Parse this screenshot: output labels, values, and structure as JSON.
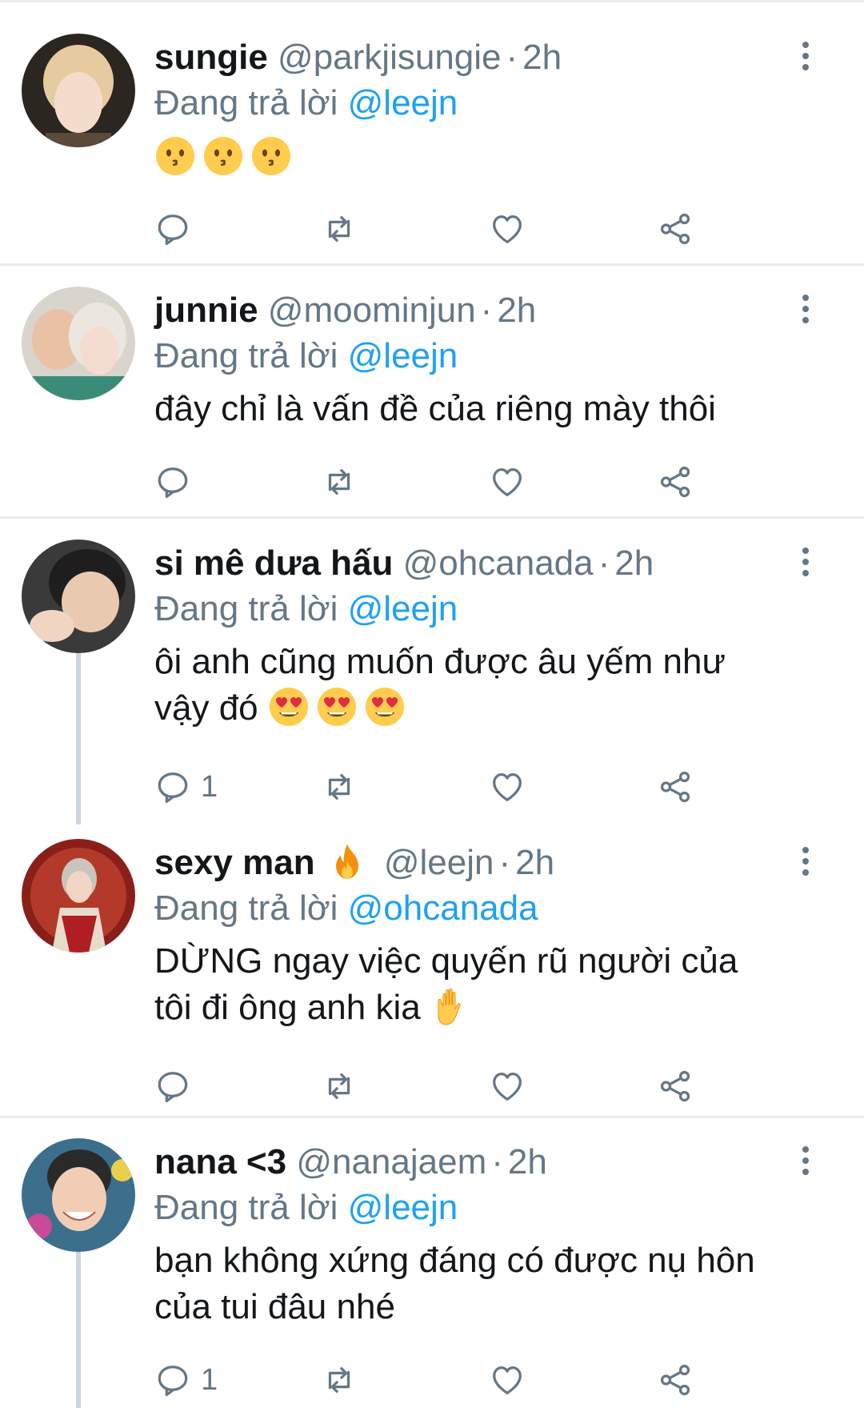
{
  "tweets": [
    {
      "name": "sungie",
      "handle": "@parkjisungie",
      "time": "2h",
      "reply_prefix": "Đang trả lời",
      "reply_to": "@leejn",
      "body_lines": [
        ""
      ],
      "emojis": [
        "kissing-face",
        "kissing-face",
        "kissing-face"
      ],
      "reply_count": ""
    },
    {
      "name": "junnie",
      "handle": "@moominjun",
      "time": "2h",
      "reply_prefix": "Đang trả lời",
      "reply_to": "@leejn",
      "body_lines": [
        "đây chỉ là vấn đề của riêng mày thôi"
      ],
      "reply_count": ""
    },
    {
      "name": "si mê dưa hấu",
      "handle": "@ohcanada",
      "time": "2h",
      "reply_prefix": "Đang trả lời",
      "reply_to": "@leejn",
      "body_lines": [
        "ôi anh cũng muốn được âu yếm như",
        "vậy đó"
      ],
      "emojis": [
        "heart-eyes-face",
        "heart-eyes-face",
        "heart-eyes-face"
      ],
      "reply_count": "1"
    },
    {
      "name": "sexy man",
      "name_emoji": "fire",
      "handle": "@leejn",
      "time": "2h",
      "reply_prefix": "Đang trả lời",
      "reply_to": "@ohcanada",
      "body_lines": [
        "DỪNG ngay việc quyến rũ người của",
        "tôi đi ông anh kia"
      ],
      "emojis": [
        "raised-hand"
      ],
      "reply_count": ""
    },
    {
      "name": "nana <3",
      "handle": "@nanajaem",
      "time": "2h",
      "reply_prefix": "Đang trả lời",
      "reply_to": "@leejn",
      "body_lines": [
        "bạn không xứng đáng có được nụ hôn",
        "của tui đâu nhé"
      ],
      "reply_count": "1"
    }
  ],
  "dot_separator": "·",
  "colors": {
    "link": "#1da1f2",
    "secondary": "#657786",
    "divider": "#e6ecf0",
    "thread_line": "#ccd6dd"
  },
  "action_icons": [
    "reply-icon",
    "retweet-icon",
    "like-icon",
    "share-icon"
  ]
}
